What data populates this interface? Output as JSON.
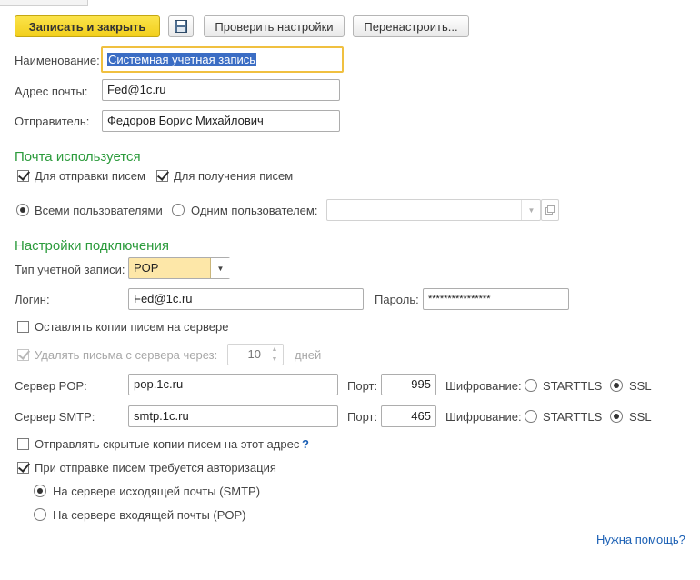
{
  "toolbar": {
    "save_close_label": "Записать и закрыть",
    "check_settings_label": "Проверить настройки",
    "reconfigure_label": "Перенастроить..."
  },
  "form": {
    "name_label": "Наименование:",
    "name_value": "Системная учетная запись",
    "email_label": "Адрес почты:",
    "email_value": "Fed@1c.ru",
    "sender_label": "Отправитель:",
    "sender_value": "Федоров Борис Михайлович"
  },
  "mail_usage": {
    "title": "Почта используется",
    "send_label": "Для отправки писем",
    "receive_label": "Для получения писем",
    "all_users_label": "Всеми пользователями",
    "one_user_label": "Одним пользователем:",
    "one_user_value": ""
  },
  "connection": {
    "title": "Настройки подключения",
    "account_type_label": "Тип учетной записи:",
    "account_type_value": "POP",
    "login_label": "Логин:",
    "login_value": "Fed@1c.ru",
    "password_label": "Пароль:",
    "password_value": "****************",
    "keep_copies_label": "Оставлять копии писем на сервере",
    "delete_after_label": "Удалять письма с сервера через:",
    "delete_days_value": "10",
    "days_label": "дней",
    "pop_server_label": "Сервер POP:",
    "pop_server_value": "pop.1c.ru",
    "pop_port_label": "Порт:",
    "pop_port_value": "995",
    "pop_enc_label": "Шифрование:",
    "smtp_server_label": "Сервер SMTP:",
    "smtp_server_value": "smtp.1c.ru",
    "smtp_port_label": "Порт:",
    "smtp_port_value": "465",
    "smtp_enc_label": "Шифрование:",
    "starttls_label": "STARTTLS",
    "ssl_label": "SSL",
    "bcc_label": "Отправлять скрытые копии писем на этот адрес",
    "bcc_help": "?",
    "auth_label": "При отправке писем требуется авторизация",
    "auth_smtp_label": "На сервере исходящей почты (SMTP)",
    "auth_pop_label": "На сервере входящей почты (POP)"
  },
  "help_link": "Нужна помощь?",
  "colors": {
    "accent_green": "#2c9b3c",
    "primary_button": "#f2cf1c",
    "focus_border": "#f0c040",
    "link": "#1a5fb4"
  }
}
